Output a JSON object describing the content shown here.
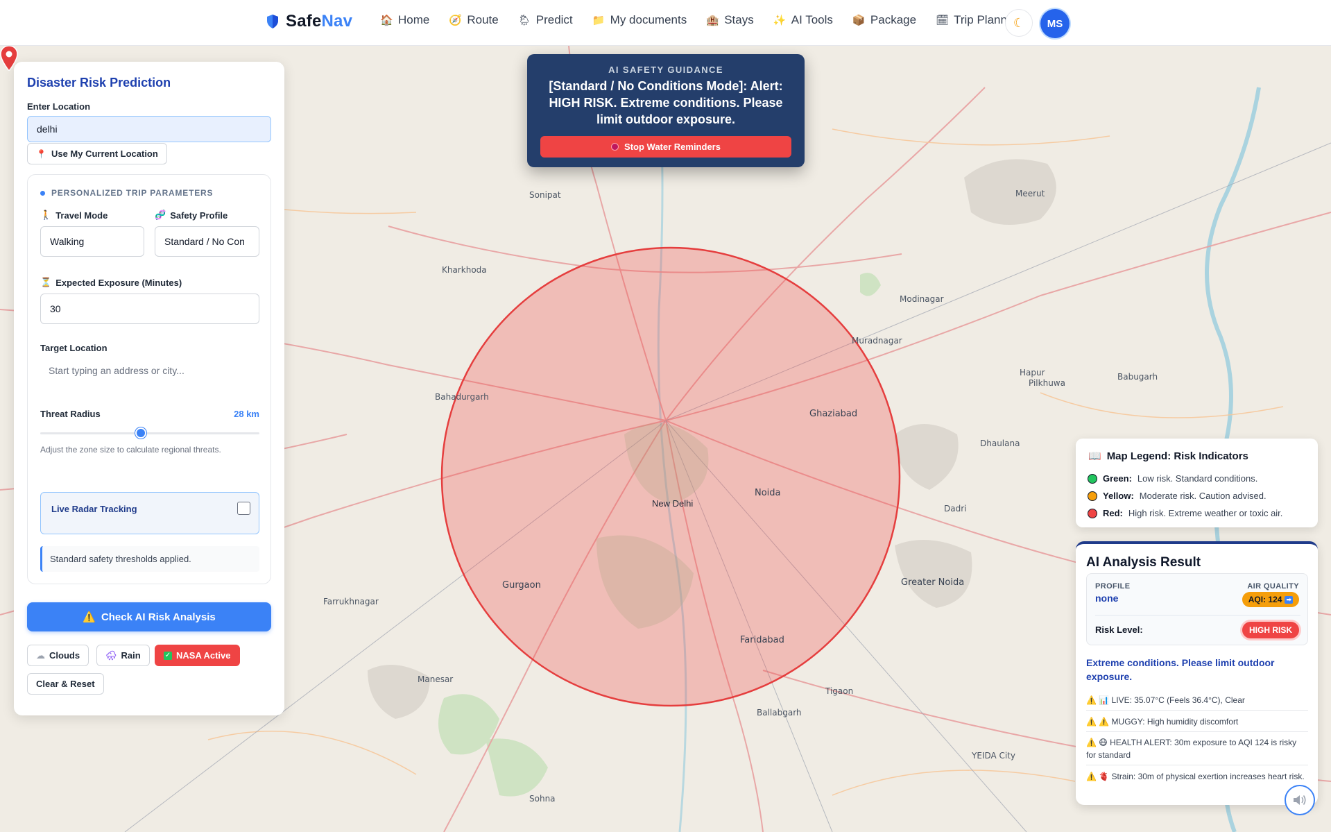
{
  "brand": {
    "name_part1": "Safe",
    "name_part2": "Nav",
    "logo_icon": "shield-icon"
  },
  "nav": [
    {
      "label": "Home",
      "icon": "home-icon",
      "glyph": "🏠"
    },
    {
      "label": "Route",
      "icon": "route-icon",
      "glyph": "🧭"
    },
    {
      "label": "Predict",
      "icon": "predict-icon",
      "glyph": "🌦"
    },
    {
      "label": "My documents",
      "icon": "folder-icon",
      "glyph": "📁"
    },
    {
      "label": "Stays",
      "icon": "hotel-icon",
      "glyph": "🏨"
    },
    {
      "label": "AI Tools",
      "icon": "magic-icon",
      "glyph": "✨"
    },
    {
      "label": "Package",
      "icon": "package-icon",
      "glyph": "📦"
    },
    {
      "label": "Trip Planner",
      "icon": "planner-icon",
      "glyph": "🗓"
    }
  ],
  "user": {
    "initials": "MS"
  },
  "panel": {
    "title": "Disaster Risk Prediction",
    "location_label": "Enter Location",
    "location_value": "delhi",
    "current_location_btn": "Use My Current Location",
    "params_heading": "PERSONALIZED TRIP PARAMETERS",
    "travel_mode_label": "Travel Mode",
    "travel_mode_value": "Walking",
    "safety_profile_label": "Safety Profile",
    "safety_profile_value": "Standard / No Con",
    "exposure_label": "Expected Exposure (Minutes)",
    "exposure_value": "30",
    "target_label": "Target Location",
    "target_placeholder": "Start typing an address or city...",
    "radius_label": "Threat Radius",
    "radius_value": "28 km",
    "radius_fraction": 0.46,
    "radius_hint": "Adjust the zone size to calculate regional threats.",
    "radar_label": "Live Radar Tracking",
    "radar_checked": false,
    "note": "Standard safety thresholds applied.",
    "check_btn": "Check AI Risk Analysis",
    "chips": {
      "clouds": "Clouds",
      "rain": "Rain",
      "nasa": "NASA Active"
    },
    "reset_btn": "Clear & Reset"
  },
  "guidance": {
    "heading": "AI SAFETY GUIDANCE",
    "message": "[Standard / No Conditions Mode]: Alert: HIGH RISK. Extreme conditions. Please limit outdoor exposure.",
    "stop_btn": "Stop Water Reminders"
  },
  "legend": {
    "title": "Map Legend: Risk Indicators",
    "items": [
      {
        "name": "Green:",
        "desc": "Low risk. Standard conditions.",
        "color": "#22c55e"
      },
      {
        "name": "Yellow:",
        "desc": "Moderate risk. Caution advised.",
        "color": "#f59e0b"
      },
      {
        "name": "Red:",
        "desc": "High risk. Extreme weather or toxic air.",
        "color": "#ef4444"
      }
    ]
  },
  "result": {
    "title": "AI Analysis Result",
    "profile_label": "PROFILE",
    "profile_value": "none",
    "aq_label": "AIR QUALITY",
    "aq_value": "AQI: 124",
    "risk_label": "Risk Level:",
    "risk_value": "HIGH RISK",
    "summary": "Extreme conditions. Please limit outdoor exposure.",
    "alerts": [
      "⚠️ 📊 LIVE: 35.07°C (Feels 36.4°C), Clear",
      "⚠️ ⚠️ MUGGY: High humidity discomfort",
      "⚠️ 😷 HEALTH ALERT: 30m exposure to AQI 124 is risky for standard",
      "⚠️ 🫀 Strain: 30m of physical exertion increases heart risk."
    ]
  },
  "map": {
    "center_label": "New Delhi",
    "zone_color": "#ef4444",
    "labels": [
      "Ghaziabad",
      "Noida",
      "Greater Noida",
      "Gurgaon",
      "Faridabad",
      "Bahadurgarh",
      "Meerut",
      "Sonipat",
      "Manesar",
      "YEIDA City",
      "Hapur",
      "Dadri",
      "Farrukhnagar",
      "Tigaon",
      "Ballabgarh",
      "Babugarh",
      "Pilkhuwa",
      "Dhaulana",
      "Modinagar",
      "Muradnagar",
      "Kharkhoda",
      "Sohna"
    ]
  },
  "colors": {
    "accent": "#3b82f6",
    "danger": "#ef4444",
    "navy": "#243e6b",
    "warning": "#f59e0b"
  }
}
